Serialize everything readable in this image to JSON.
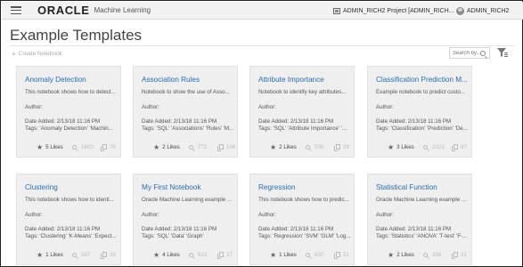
{
  "header": {
    "brand": "ORACLE",
    "product": "Machine Learning",
    "project_label": "ADMIN_RICH2 Project [ADMIN_RICH...",
    "user_label": "ADMIN_RICH2"
  },
  "page": {
    "title": "Example Templates",
    "create_label": "Create Notebook",
    "search_placeholder": "Search by..."
  },
  "cards": [
    {
      "title": "Anomaly Detection",
      "desc": "This notebook shows how to detect...",
      "author": "Author:",
      "date": "Date Added: 2/13/18 11:16 PM",
      "tags": "Tags: 'Anomaly Detection' 'Machin...",
      "likes": "5 Likes",
      "views": "1600",
      "copies": "76"
    },
    {
      "title": "Association Rules",
      "desc": "Notebook to show the use of Asso...",
      "author": "Author:",
      "date": "Date Added: 2/13/18 11:16 PM",
      "tags": "Tags: 'SQL' 'Associations' 'Rules' 'M...",
      "likes": "2 Likes",
      "views": "772",
      "copies": "106"
    },
    {
      "title": "Attribute Importance",
      "desc": "Notebook to identify key attributes...",
      "author": "Author:",
      "date": "Date Added: 2/13/18 11:16 PM",
      "tags": "Tags: 'SQL' 'Attribute Importance' '...",
      "likes": "2 Likes",
      "views": "530",
      "copies": "29"
    },
    {
      "title": "Classification Prediction M...",
      "desc": "Example notebook to predict custo...",
      "author": "Author:",
      "date": "Date Added: 2/13/18 11:16 PM",
      "tags": "Tags: 'Classification' 'Prediction' 'De...",
      "likes": "3 Likes",
      "views": "1021",
      "copies": "97"
    },
    {
      "title": "Clustering",
      "desc": "This notebook shows how to identi...",
      "author": "Author:",
      "date": "Date Added: 2/13/18 11:16 PM",
      "tags": "Tags: 'Clustering' 'K-Means' 'Expect...",
      "likes": "1 Likes",
      "views": "597",
      "copies": "35"
    },
    {
      "title": "My First Notebook",
      "desc": "Oracle Machine Learning example ...",
      "author": "Author:",
      "date": "Date Added: 2/13/18 11:16 PM",
      "tags": "Tags: 'SQL' 'Data' 'Graph'",
      "likes": "4 Likes",
      "views": "913",
      "copies": "27"
    },
    {
      "title": "Regression",
      "desc": "This notebook shows how to predic...",
      "author": "Author:",
      "date": "Date Added: 2/13/18 11:16 PM",
      "tags": "Tags: 'Regression' 'SVM' 'GLM' 'Log...",
      "likes": "1 Likes",
      "views": "837",
      "copies": "31"
    },
    {
      "title": "Statistical Function",
      "desc": "Oracle Machine Learning example ...",
      "author": "Author:",
      "date": "Date Added: 2/13/18 11:16 PM",
      "tags": "Tags: 'Statistics' 'ANOVA' 'T-test' 'F-...",
      "likes": "2 Likes",
      "views": "356",
      "copies": "31"
    }
  ]
}
